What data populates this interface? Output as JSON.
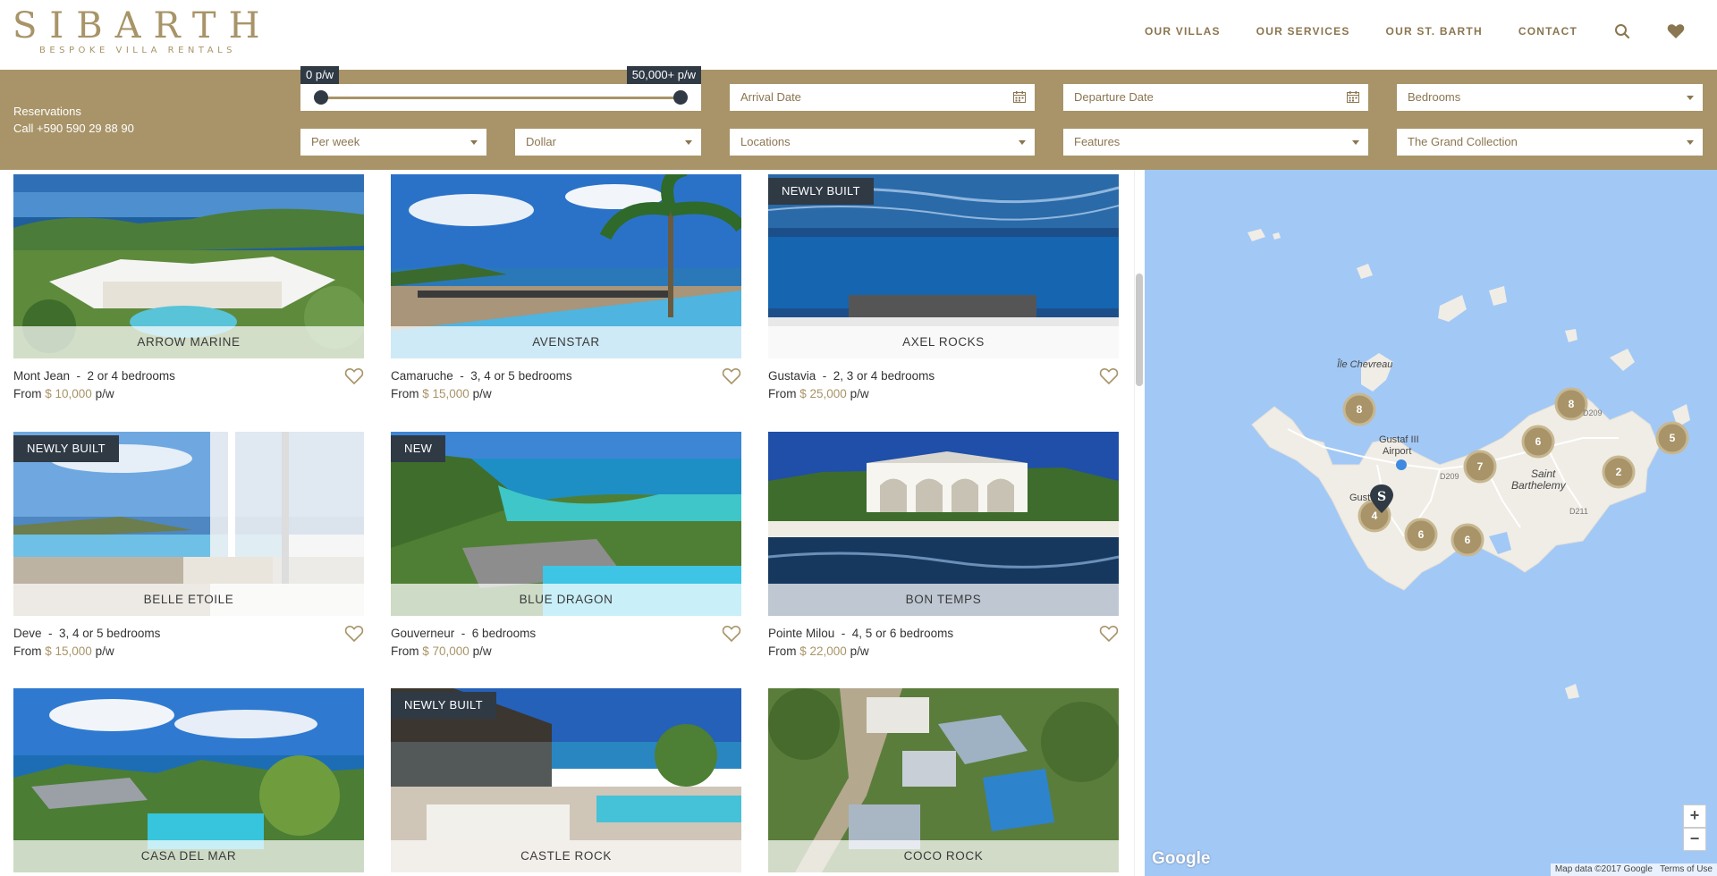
{
  "brand": {
    "name": "SIBARTH",
    "tagline": "BESPOKE VILLA RENTALS"
  },
  "nav": {
    "items": [
      "OUR VILLAS",
      "OUR SERVICES",
      "OUR ST. BARTH",
      "CONTACT"
    ],
    "search_icon": "search-icon",
    "favorites_icon": "heart-icon"
  },
  "filters": {
    "reservations_title": "Reservations",
    "reservations_phone": "Call +590 590 29 88 90",
    "price_min_label": "0 p/w",
    "price_max_label": "50,000+ p/w",
    "arrival_placeholder": "Arrival Date",
    "departure_placeholder": "Departure Date",
    "bedrooms": "Bedrooms",
    "period": "Per week",
    "currency": "Dollar",
    "locations": "Locations",
    "features": "Features",
    "collection": "The Grand Collection"
  },
  "villas": [
    {
      "name": "ARROW MARINE",
      "location": "Mont Jean",
      "bedrooms": "2 or 4 bedrooms",
      "price_prefix": "From",
      "price": "$ 10,000",
      "price_suffix": "p/w",
      "badge": ""
    },
    {
      "name": "AVENSTAR",
      "location": "Camaruche",
      "bedrooms": "3, 4 or 5 bedrooms",
      "price_prefix": "From",
      "price": "$ 15,000",
      "price_suffix": "p/w",
      "badge": ""
    },
    {
      "name": "AXEL ROCKS",
      "location": "Gustavia",
      "bedrooms": "2, 3 or 4 bedrooms",
      "price_prefix": "From",
      "price": "$ 25,000",
      "price_suffix": "p/w",
      "badge": "NEWLY BUILT"
    },
    {
      "name": "BELLE ETOILE",
      "location": "Deve",
      "bedrooms": "3, 4 or 5 bedrooms",
      "price_prefix": "From",
      "price": "$ 15,000",
      "price_suffix": "p/w",
      "badge": "NEWLY BUILT"
    },
    {
      "name": "BLUE DRAGON",
      "location": "Gouverneur",
      "bedrooms": "6 bedrooms",
      "price_prefix": "From",
      "price": "$ 70,000",
      "price_suffix": "p/w",
      "badge": "NEW"
    },
    {
      "name": "BON TEMPS",
      "location": "Pointe Milou",
      "bedrooms": "4, 5 or 6 bedrooms",
      "price_prefix": "From",
      "price": "$ 22,000",
      "price_suffix": "p/w",
      "badge": ""
    },
    {
      "name": "CASA DEL MAR",
      "location": "",
      "bedrooms": "",
      "price_prefix": "",
      "price": "",
      "price_suffix": "",
      "badge": ""
    },
    {
      "name": "CASTLE ROCK",
      "location": "",
      "bedrooms": "",
      "price_prefix": "",
      "price": "",
      "price_suffix": "",
      "badge": "NEWLY BUILT"
    },
    {
      "name": "COCO ROCK",
      "location": "",
      "bedrooms": "",
      "price_prefix": "",
      "price": "",
      "price_suffix": "",
      "badge": ""
    }
  ],
  "map": {
    "labels": [
      "Île Chevreau",
      "Gustaf III",
      "Airport",
      "Saint",
      "Barthelemy",
      "Gust",
      "D209",
      "D209",
      "D211"
    ],
    "clusters": [
      "8",
      "8",
      "6",
      "7",
      "2",
      "5",
      "4",
      "6",
      "6"
    ],
    "marker_letter": "S",
    "zoom_in": "+",
    "zoom_out": "−",
    "google": "Google",
    "attribution": "Map data ©2017 Google",
    "terms": "Terms of Use"
  },
  "colors": {
    "gold": "#a89468",
    "dark": "#2f3a45",
    "sea": "#a2c8f6",
    "land": "#f0ede6"
  }
}
